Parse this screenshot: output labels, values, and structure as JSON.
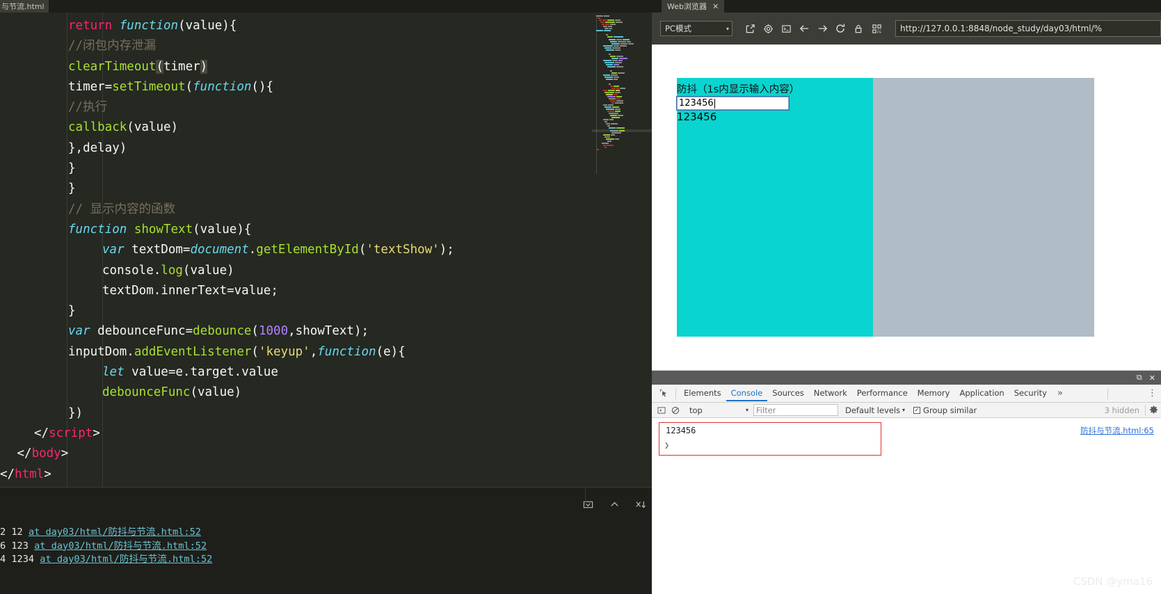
{
  "ide": {
    "tab_label": "与节流.html",
    "code_lines": [
      {
        "indent": 4,
        "tokens": [
          {
            "t": "return ",
            "c": "kw"
          },
          {
            "t": "function",
            "c": "fnkw"
          },
          {
            "t": "(value){",
            "c": "plain"
          }
        ]
      },
      {
        "indent": 4,
        "tokens": [
          {
            "t": "//闭包内存泄漏",
            "c": "cmt"
          }
        ]
      },
      {
        "indent": 4,
        "tokens": [
          {
            "t": "clearTimeout",
            "c": "fname"
          },
          {
            "t": "(",
            "c": "brmatch"
          },
          {
            "t": "timer",
            "c": "plain"
          },
          {
            "t": ")",
            "c": "brmatch"
          }
        ]
      },
      {
        "indent": 4,
        "tokens": [
          {
            "t": "timer=",
            "c": "plain"
          },
          {
            "t": "setTimeout",
            "c": "fname"
          },
          {
            "t": "(",
            "c": "plain"
          },
          {
            "t": "function",
            "c": "fnkw"
          },
          {
            "t": "(){",
            "c": "plain"
          }
        ]
      },
      {
        "indent": 4,
        "tokens": [
          {
            "t": "//执行",
            "c": "cmt"
          }
        ]
      },
      {
        "indent": 4,
        "tokens": [
          {
            "t": "callback",
            "c": "fname"
          },
          {
            "t": "(value)",
            "c": "plain"
          }
        ]
      },
      {
        "indent": 4,
        "tokens": [
          {
            "t": "},delay)",
            "c": "plain"
          }
        ]
      },
      {
        "indent": 4,
        "tokens": [
          {
            "t": "}",
            "c": "plain"
          }
        ]
      },
      {
        "indent": 4,
        "tokens": [
          {
            "t": "}",
            "c": "plain"
          }
        ]
      },
      {
        "indent": 4,
        "tokens": [
          {
            "t": "// 显示内容的函数",
            "c": "cmt"
          }
        ]
      },
      {
        "indent": 4,
        "tokens": [
          {
            "t": "function ",
            "c": "fnkw"
          },
          {
            "t": "showText",
            "c": "fname"
          },
          {
            "t": "(value){",
            "c": "plain"
          }
        ]
      },
      {
        "indent": 6,
        "tokens": [
          {
            "t": "var ",
            "c": "fnkw"
          },
          {
            "t": "textDom=",
            "c": "plain"
          },
          {
            "t": "document",
            "c": "fnkw"
          },
          {
            "t": ".",
            "c": "plain"
          },
          {
            "t": "getElementById",
            "c": "fname"
          },
          {
            "t": "(",
            "c": "plain"
          },
          {
            "t": "'textShow'",
            "c": "str"
          },
          {
            "t": ");",
            "c": "plain"
          }
        ]
      },
      {
        "indent": 6,
        "tokens": [
          {
            "t": "console.",
            "c": "plain"
          },
          {
            "t": "log",
            "c": "fname"
          },
          {
            "t": "(value)",
            "c": "plain"
          }
        ]
      },
      {
        "indent": 6,
        "tokens": [
          {
            "t": "textDom.innerText=value;",
            "c": "plain"
          }
        ]
      },
      {
        "indent": 4,
        "tokens": [
          {
            "t": "}",
            "c": "plain"
          }
        ]
      },
      {
        "indent": 4,
        "tokens": [
          {
            "t": "var ",
            "c": "fnkw"
          },
          {
            "t": "debounceFunc=",
            "c": "plain"
          },
          {
            "t": "debounce",
            "c": "fname"
          },
          {
            "t": "(",
            "c": "plain"
          },
          {
            "t": "1000",
            "c": "num"
          },
          {
            "t": ",showText);",
            "c": "plain"
          }
        ]
      },
      {
        "indent": 4,
        "tokens": [
          {
            "t": "inputDom.",
            "c": "plain"
          },
          {
            "t": "addEventListener",
            "c": "fname"
          },
          {
            "t": "(",
            "c": "plain"
          },
          {
            "t": "'keyup'",
            "c": "str"
          },
          {
            "t": ",",
            "c": "plain"
          },
          {
            "t": "function",
            "c": "fnkw"
          },
          {
            "t": "(e){",
            "c": "plain"
          }
        ]
      },
      {
        "indent": 6,
        "tokens": [
          {
            "t": "let ",
            "c": "fnkw"
          },
          {
            "t": "value=e.target.value",
            "c": "plain"
          }
        ]
      },
      {
        "indent": 6,
        "tokens": [
          {
            "t": "debounceFunc",
            "c": "fname"
          },
          {
            "t": "(value)",
            "c": "plain"
          }
        ]
      },
      {
        "indent": 4,
        "tokens": [
          {
            "t": "})",
            "c": "plain"
          }
        ]
      },
      {
        "indent": 2,
        "tokens": [
          {
            "t": "</",
            "c": "plain"
          },
          {
            "t": "script",
            "c": "tag"
          },
          {
            "t": ">",
            "c": "plain"
          }
        ]
      },
      {
        "indent": 1,
        "tokens": [
          {
            "t": "</",
            "c": "plain"
          },
          {
            "t": "body",
            "c": "tag"
          },
          {
            "t": ">",
            "c": "plain"
          }
        ]
      },
      {
        "indent": 0,
        "tokens": [
          {
            "t": "</",
            "c": "plain"
          },
          {
            "t": "html",
            "c": "tag"
          },
          {
            "t": ">",
            "c": "plain"
          }
        ]
      }
    ],
    "bottom_toolbar": [
      {
        "name": "export-icon",
        "glyph": "⇱"
      },
      {
        "name": "chevron-up-icon",
        "glyph": "^"
      },
      {
        "name": "clear-all-icon",
        "glyph": "x↓"
      }
    ],
    "console_rows": [
      {
        "col1": "2",
        "col2": "12",
        "link": "at day03/html/防抖与节流.html:52"
      },
      {
        "col1": "6",
        "col2": "123",
        "link": "at day03/html/防抖与节流.html:52"
      },
      {
        "col1": "4",
        "col2": "1234",
        "link": "at day03/html/防抖与节流.html:52"
      }
    ]
  },
  "browser": {
    "tab_label": "Web浏览器",
    "tab_close": "✕",
    "mode_select": {
      "value": "PC模式",
      "caret": "▾"
    },
    "toolbar_buttons": [
      {
        "name": "open-external-icon",
        "glyph": "⇱"
      },
      {
        "name": "settings-gear-icon",
        "glyph": "⚙"
      },
      {
        "name": "console-icon",
        "glyph": "▣"
      },
      {
        "name": "back-arrow-icon",
        "glyph": "←"
      },
      {
        "name": "forward-arrow-icon",
        "glyph": "→"
      },
      {
        "name": "reload-icon",
        "glyph": "⟳"
      },
      {
        "name": "lock-icon",
        "glyph": "🔒"
      },
      {
        "name": "qrcode-icon",
        "glyph": "▦"
      }
    ],
    "url": "http://127.0.0.1:8848/node_study/day03/html/%",
    "page": {
      "heading": "防抖（1s内显示输入内容）",
      "input_value": "123456",
      "output_text": "123456",
      "teal_color": "#0ad4cf",
      "panel_color": "#b0bdc6"
    }
  },
  "devtools": {
    "title_icons": [
      {
        "name": "dock-side-icon",
        "glyph": "⧉"
      },
      {
        "name": "close-icon",
        "glyph": "✕"
      }
    ],
    "inspect_icon": "⬚",
    "tabs": [
      {
        "label": "Elements",
        "active": false
      },
      {
        "label": "Console",
        "active": true
      },
      {
        "label": "Sources",
        "active": false
      },
      {
        "label": "Network",
        "active": false
      },
      {
        "label": "Performance",
        "active": false
      },
      {
        "label": "Memory",
        "active": false
      },
      {
        "label": "Application",
        "active": false
      },
      {
        "label": "Security",
        "active": false
      }
    ],
    "more_tabs": "»",
    "kebab": "⋮",
    "filterbar": {
      "execute_icon": "▶",
      "clear_icon": "⃠",
      "context": "top",
      "context_caret": "▾",
      "filter_placeholder": "Filter",
      "levels_label": "Default levels",
      "levels_caret": "▾",
      "group_similar_label": "Group similar",
      "group_similar_checked": "✓",
      "hidden_count": "3 hidden",
      "gear_icon": "⚙"
    },
    "console": {
      "message": "123456",
      "source_link": "防抖与节流.html:65",
      "prompt": "❯",
      "highlight_color": "#e03030"
    }
  },
  "watermark": "CSDN @yma16"
}
